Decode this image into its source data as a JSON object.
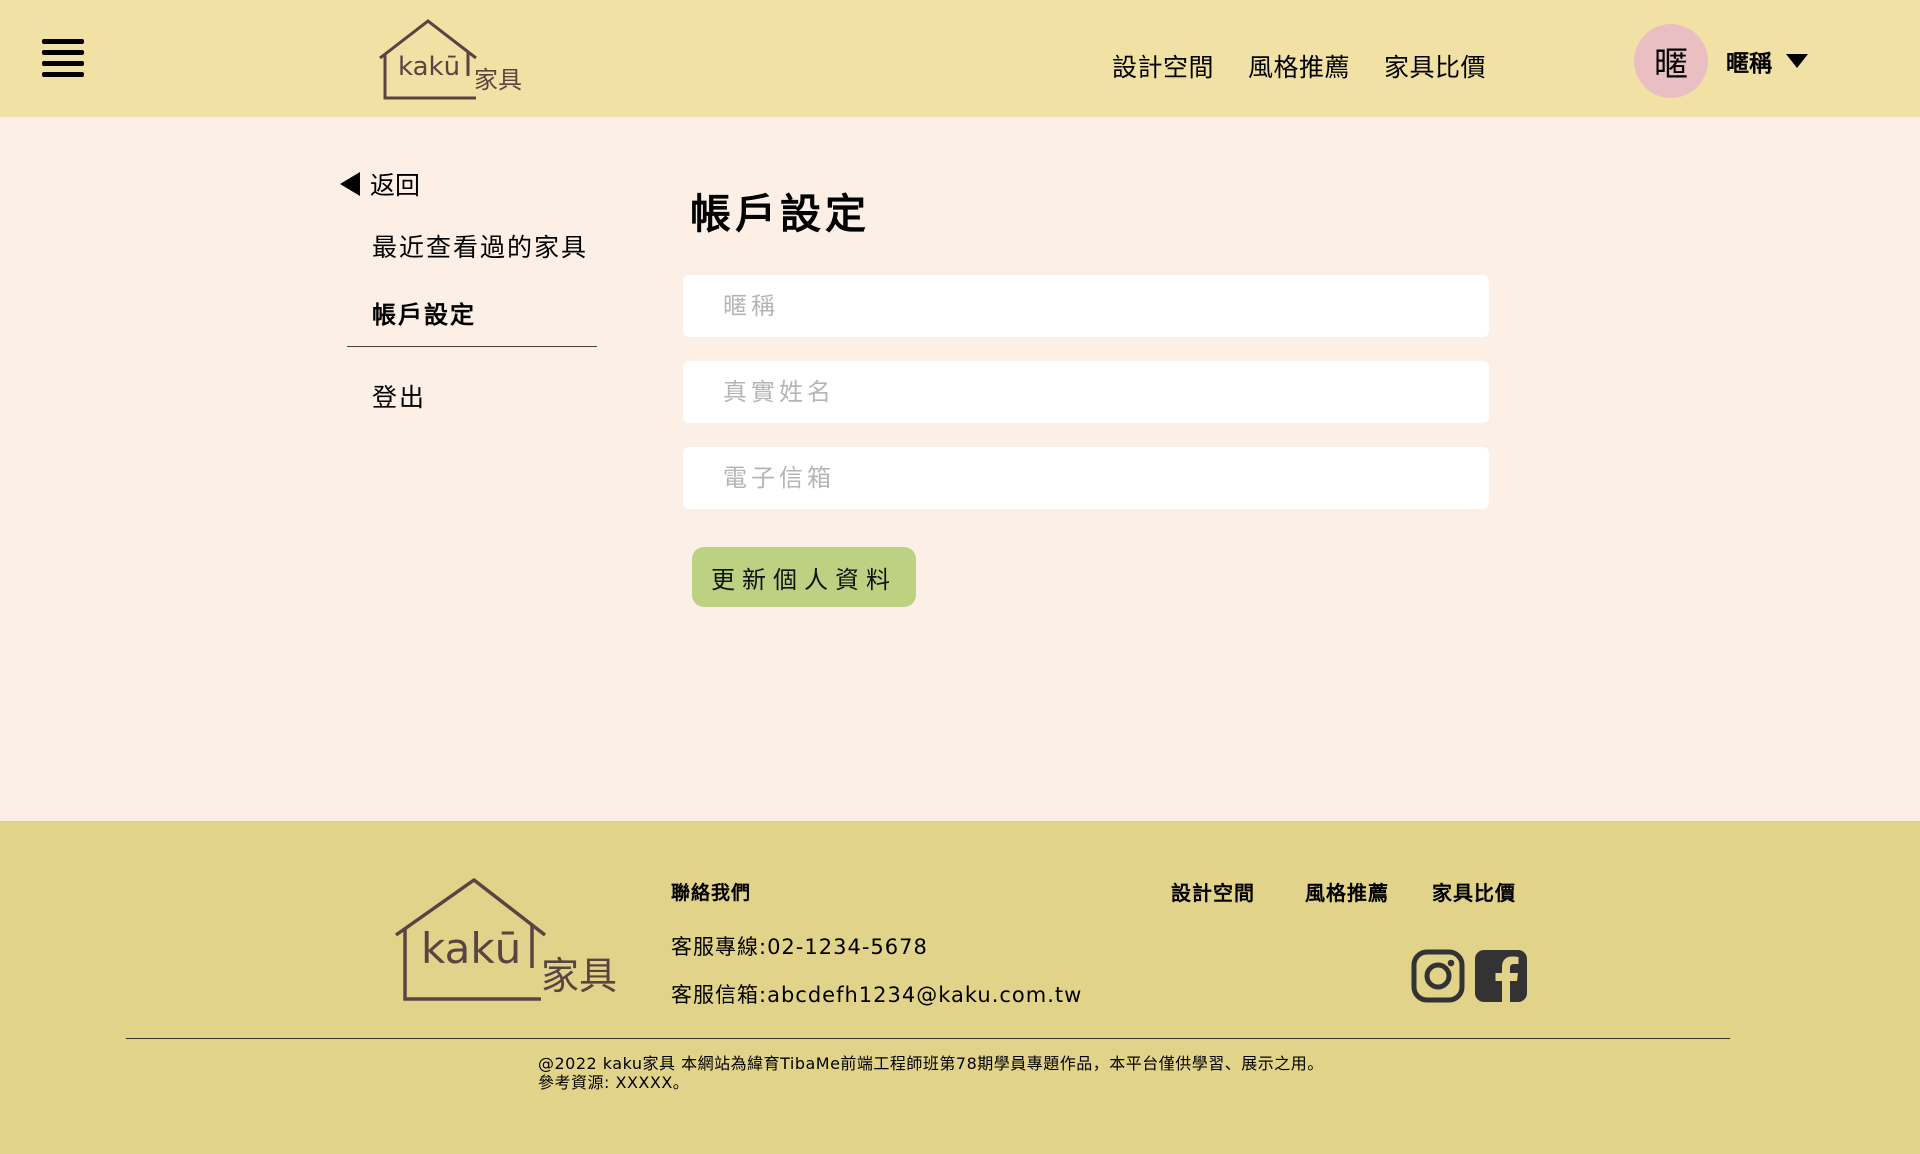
{
  "header": {
    "nav": [
      "設計空間",
      "風格推薦",
      "家具比價"
    ],
    "avatar_char": "暱",
    "user_name": "暱稱"
  },
  "logo": {
    "word": "kakū",
    "suffix": "家具"
  },
  "sidebar": {
    "back_label": "返回",
    "items": [
      {
        "label": "最近查看過的家具",
        "active": false
      },
      {
        "label": "帳戶設定",
        "active": true
      },
      {
        "label": "登出",
        "active": false
      }
    ]
  },
  "main": {
    "title": "帳戶設定",
    "fields": [
      {
        "placeholder": "暱稱",
        "value": ""
      },
      {
        "placeholder": "真實姓名",
        "value": ""
      },
      {
        "placeholder": "電子信箱",
        "value": ""
      }
    ],
    "submit_label": "更新個人資料"
  },
  "footer": {
    "contact_title": "聯絡我們",
    "phone": "客服專線:02-1234-5678",
    "email": "客服信箱:abcdefh1234@kaku.com.tw",
    "nav": [
      "設計空間",
      "風格推薦",
      "家具比價"
    ],
    "social": [
      "instagram-icon",
      "facebook-icon"
    ],
    "copyright_line1": "@2022 kaku家具 本網站為緯育TibaMe前端工程師班第78期學員專題作品，本平台僅供學習、展示之用。",
    "copyright_line2": "參考資源: XXXXX。"
  },
  "colors": {
    "header_bg": "#f1e1a5",
    "page_bg": "#fcefe6",
    "footer_bg": "#e2d38b",
    "avatar_bg": "#e9bfc4",
    "button_bg": "#bcd282",
    "logo_color": "#5a4442"
  }
}
